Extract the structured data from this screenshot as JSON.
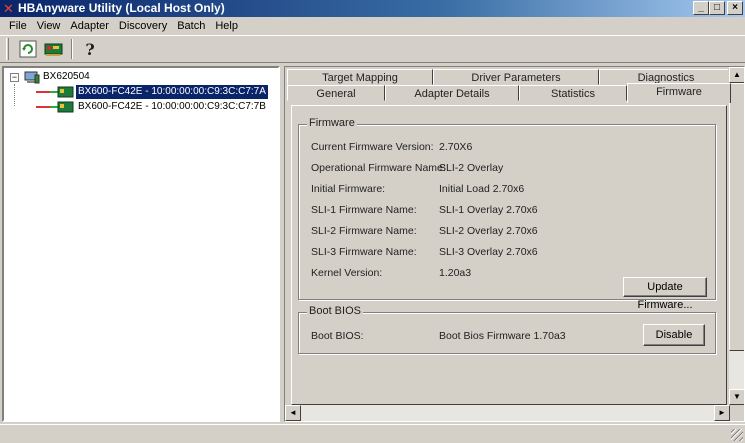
{
  "window": {
    "title": "HBAnyware Utility (Local Host Only)",
    "app_icon": "hbanyware-x-icon",
    "controls": {
      "minimize": "_",
      "maximize": "□",
      "close": "×"
    }
  },
  "menu": [
    "File",
    "View",
    "Adapter",
    "Discovery",
    "Batch",
    "Help"
  ],
  "toolbar": {
    "buttons": [
      {
        "name": "refresh-icon"
      },
      {
        "name": "hba-card-icon"
      },
      {
        "name": "help-icon",
        "glyph": "?"
      }
    ]
  },
  "tree": {
    "host": "BX620504",
    "expander": "−",
    "adapters": [
      {
        "label": "BX600-FC42E - 10:00:00:00:C9:3C:C7:7A",
        "selected": true
      },
      {
        "label": "BX600-FC42E - 10:00:00:00:C9:3C:C7:7B",
        "selected": false
      }
    ]
  },
  "tabs": {
    "row_back": [
      "Target Mapping",
      "Driver Parameters",
      "Diagnostics"
    ],
    "row_front": [
      "General",
      "Adapter Details",
      "Statistics",
      "Firmware"
    ],
    "active": "Firmware"
  },
  "firmware": {
    "group_title": "Firmware",
    "rows": [
      {
        "label": "Current Firmware Version:",
        "value": "2.70X6"
      },
      {
        "label": "Operational Firmware Name:",
        "value": "SLI-2 Overlay"
      },
      {
        "label": "Initial Firmware:",
        "value": "Initial Load 2.70x6"
      },
      {
        "label": "SLI-1 Firmware Name:",
        "value": "SLI-1 Overlay 2.70x6"
      },
      {
        "label": "SLI-2 Firmware Name:",
        "value": "SLI-2 Overlay 2.70x6"
      },
      {
        "label": "SLI-3 Firmware Name:",
        "value": "SLI-3 Overlay 2.70x6"
      },
      {
        "label": "Kernel Version:",
        "value": "1.20a3"
      }
    ],
    "update_button": "Update Firmware..."
  },
  "boot_bios": {
    "group_title": "Boot BIOS",
    "label": "Boot BIOS:",
    "value": "Boot Bios Firmware 1.70a3",
    "disable_button": "Disable"
  },
  "scrollbar": {
    "up": "▲",
    "down": "▼",
    "left": "◄",
    "right": "►"
  },
  "colors": {
    "title_start": "#0a246a",
    "title_end": "#a6caf0",
    "selection": "#0a246a",
    "face": "#d4d0c8"
  }
}
